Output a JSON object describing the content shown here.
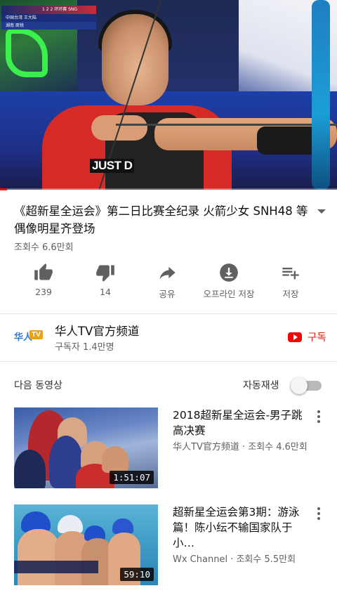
{
  "player": {
    "overlay_row1": "1  2  2  环环赛  SNG",
    "overlay_row2": "中国台湾   王大陆",
    "overlay_row3": "湖南     周锐",
    "shirt_text": "JUST D",
    "progress_fraction": 0.02
  },
  "video": {
    "title": "《超新星全运会》第二日比赛全纪录 火箭少女 SNH48 等偶像明星齐登场",
    "views": "조회수 6.6만회"
  },
  "actions": [
    {
      "icon": "thumbs-up-icon",
      "label": "239"
    },
    {
      "icon": "thumbs-down-icon",
      "label": "14"
    },
    {
      "icon": "share-icon",
      "label": "공유"
    },
    {
      "icon": "download-icon",
      "label": "오프라인 저장"
    },
    {
      "icon": "add-to-playlist-icon",
      "label": "저장"
    }
  ],
  "channel": {
    "logo_text": "华人",
    "logo_badge": "TV",
    "name": "华人TV官方频道",
    "subscribers": "구독자 1.4만명",
    "subscribe_label": "구독"
  },
  "up_next": {
    "label": "다음 동영상",
    "autoplay_label": "자동재생",
    "autoplay_on": false
  },
  "videos": [
    {
      "title": "2018超新星全运会-男子跳高决赛",
      "meta": "华人TV官方频道 · 조회수 4.6만회",
      "duration": "1:51:07"
    },
    {
      "title": "超新星全运会第3期：游泳篇！陈小纭不输国家队于小…",
      "meta": "Wx Channel · 조회수 5.5만회",
      "duration": "59:10"
    }
  ],
  "colors": {
    "accent": "#ff0000",
    "subscribe": "#e62117",
    "secondary_text": "#606060"
  }
}
